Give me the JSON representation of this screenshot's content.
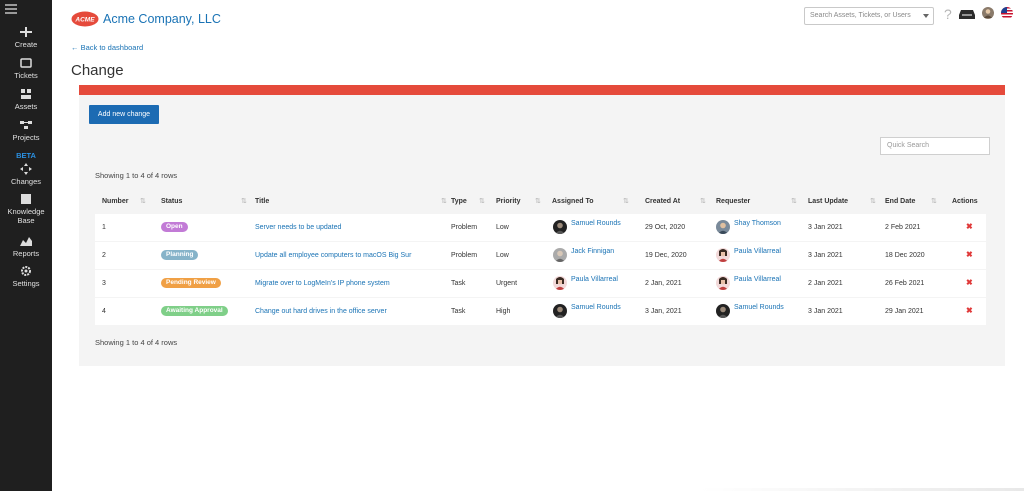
{
  "sidebar": {
    "items": [
      {
        "label": "Create",
        "icon": "plus-icon"
      },
      {
        "label": "Tickets",
        "icon": "ticket-icon"
      },
      {
        "label": "Assets",
        "icon": "assets-icon"
      },
      {
        "label": "Projects",
        "icon": "projects-icon"
      },
      {
        "label": "Changes",
        "icon": "changes-icon",
        "badge": "BETA"
      },
      {
        "label": "Knowledge",
        "label2": "Base",
        "icon": "book-icon"
      },
      {
        "label": "Reports",
        "icon": "chart-icon"
      },
      {
        "label": "Settings",
        "icon": "gear-icon"
      }
    ]
  },
  "header": {
    "logo_text": "ACME",
    "company": "Acme Company, LLC",
    "search_placeholder": "Search Assets, Tickets, or Users",
    "help": "?"
  },
  "page": {
    "back_link": "← Back to dashboard",
    "title": "Change",
    "add_button": "Add new change",
    "quick_search_placeholder": "Quick Search",
    "showing_top": "Showing 1 to 4 of 4 rows",
    "showing_bottom": "Showing 1 to 4 of 4 rows"
  },
  "table": {
    "columns": [
      "Number",
      "Status",
      "Title",
      "Type",
      "Priority",
      "Assigned To",
      "Created At",
      "Requester",
      "Last Update",
      "End Date",
      "Actions"
    ],
    "rows": [
      {
        "number": "1",
        "status": "Open",
        "status_color": "#c27bd6",
        "title": "Server needs to be updated",
        "type": "Problem",
        "priority": "Low",
        "assigned": "Samuel Rounds",
        "created": "29 Oct, 2020",
        "requester": "Shay Thomson",
        "last_update": "3 Jan 2021",
        "end_date": "2 Feb 2021",
        "action": "✖"
      },
      {
        "number": "2",
        "status": "Planning",
        "status_color": "#86b3c9",
        "title": "Update all employee computers to macOS Big Sur",
        "type": "Problem",
        "priority": "Low",
        "assigned": "Jack Finnigan",
        "created": "19 Dec, 2020",
        "requester": "Paula Villarreal",
        "last_update": "3 Jan 2021",
        "end_date": "18 Dec 2020",
        "action": "✖"
      },
      {
        "number": "3",
        "status": "Pending Review",
        "status_color": "#f0a045",
        "title": "Migrate over to LogMeIn's IP phone system",
        "type": "Task",
        "priority": "Urgent",
        "assigned": "Paula Villarreal",
        "created": "2 Jan, 2021",
        "requester": "Paula Villarreal",
        "last_update": "2 Jan 2021",
        "end_date": "26 Feb 2021",
        "action": "✖"
      },
      {
        "number": "4",
        "status": "Awaiting Approval",
        "status_color": "#7fcf88",
        "title": "Change out hard drives in the office server",
        "type": "Task",
        "priority": "High",
        "assigned": "Samuel Rounds",
        "created": "3 Jan, 2021",
        "requester": "Samuel Rounds",
        "last_update": "3 Jan 2021",
        "end_date": "29 Jan 2021",
        "action": "✖"
      }
    ]
  },
  "colors": {
    "brand_red": "#e54a3b",
    "link_blue": "#1a73b5",
    "button_blue": "#1c6bb3",
    "sidebar_bg": "#1f1f1f"
  }
}
